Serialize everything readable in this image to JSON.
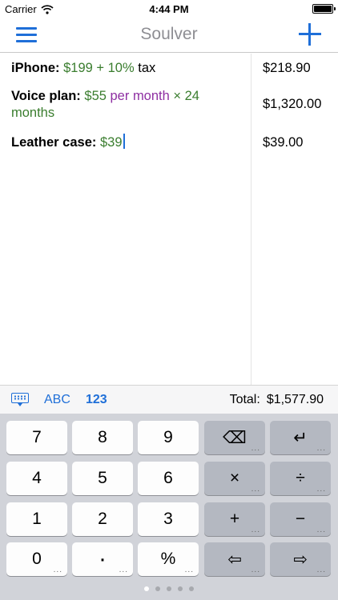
{
  "status_bar": {
    "carrier": "Carrier",
    "time": "4:44 PM"
  },
  "nav": {
    "title": "Soulver"
  },
  "lines": [
    {
      "label": "iPhone:",
      "parts": [
        {
          "text": " ",
          "kind": "plain"
        },
        {
          "text": "$199",
          "kind": "num"
        },
        {
          "text": " + ",
          "kind": "num"
        },
        {
          "text": "10%",
          "kind": "num"
        },
        {
          "text": " tax",
          "kind": "plain"
        }
      ]
    },
    {
      "label": "Voice plan:",
      "parts": [
        {
          "text": " ",
          "kind": "plain"
        },
        {
          "text": "$55",
          "kind": "num"
        },
        {
          "text": " per month",
          "kind": "purple"
        },
        {
          "text": " × 24 months",
          "kind": "num"
        }
      ]
    },
    {
      "label": "Leather case:",
      "parts": [
        {
          "text": " ",
          "kind": "plain"
        },
        {
          "text": "$39",
          "kind": "num"
        }
      ]
    }
  ],
  "answers": [
    "$218.90",
    "$1,320.00",
    "$39.00"
  ],
  "accessory": {
    "abc": "ABC",
    "num": "123",
    "total_label": "Total:",
    "total_value": "$1,577.90"
  },
  "keys": [
    {
      "label": "7",
      "op": false,
      "more": false,
      "name": "key-7"
    },
    {
      "label": "8",
      "op": false,
      "more": false,
      "name": "key-8"
    },
    {
      "label": "9",
      "op": false,
      "more": false,
      "name": "key-9"
    },
    {
      "label": "⌫",
      "op": true,
      "more": true,
      "name": "key-delete"
    },
    {
      "label": "↵",
      "op": true,
      "more": true,
      "name": "key-return"
    },
    {
      "label": "4",
      "op": false,
      "more": false,
      "name": "key-4"
    },
    {
      "label": "5",
      "op": false,
      "more": false,
      "name": "key-5"
    },
    {
      "label": "6",
      "op": false,
      "more": false,
      "name": "key-6"
    },
    {
      "label": "×",
      "op": true,
      "more": true,
      "name": "key-multiply"
    },
    {
      "label": "÷",
      "op": true,
      "more": true,
      "name": "key-divide"
    },
    {
      "label": "1",
      "op": false,
      "more": false,
      "name": "key-1"
    },
    {
      "label": "2",
      "op": false,
      "more": false,
      "name": "key-2"
    },
    {
      "label": "3",
      "op": false,
      "more": false,
      "name": "key-3"
    },
    {
      "label": "+",
      "op": true,
      "more": true,
      "name": "key-plus"
    },
    {
      "label": "−",
      "op": true,
      "more": true,
      "name": "key-minus"
    },
    {
      "label": "0",
      "op": false,
      "more": true,
      "name": "key-0"
    },
    {
      "label": "·",
      "op": false,
      "more": true,
      "name": "key-decimal"
    },
    {
      "label": "%",
      "op": false,
      "more": true,
      "name": "key-percent"
    },
    {
      "label": "⇦",
      "op": true,
      "more": true,
      "name": "key-left-arrow"
    },
    {
      "label": "⇨",
      "op": true,
      "more": true,
      "name": "key-right-arrow"
    }
  ],
  "page_dots": {
    "count": 5,
    "active": 0
  },
  "colors": {
    "accent": "#1f6fd8",
    "number": "#3a7d2e",
    "unit": "#8e2fa2"
  }
}
